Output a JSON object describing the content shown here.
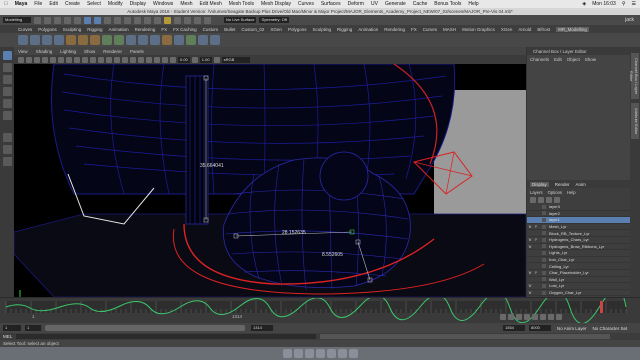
{
  "menubar": {
    "app": "Maya",
    "items": [
      "File",
      "Edit",
      "Create",
      "Select",
      "Modify",
      "Display",
      "Windows",
      "Mesh",
      "Edit Mesh",
      "Mesh Tools",
      "Mesh Display",
      "Curves",
      "Surfaces",
      "Deform",
      "UV",
      "Generate",
      "Cache",
      "Bonus Tools",
      "Help"
    ],
    "time": "Mon 16:03"
  },
  "window": {
    "title": "Autodesk Maya 2018 - Student Version: /Volumes/Seagate Backup Plus Drive/Old Mac/Minor & Major Project/MAJOR_Elements_Academy_Project_NEW/07_03/scenes/MAJOR_Pre-Vis 04.mb*"
  },
  "statusline": {
    "mode": "Modelling",
    "no_live": "No Live Surface",
    "symmetry": "Symmetry: Off",
    "user": "jack"
  },
  "shelftabs": {
    "items": [
      "Curves",
      "Polygons",
      "Sculpting",
      "Rigging",
      "Animation",
      "Rendering",
      "FX",
      "FX Caching",
      "Custom",
      "Bullet",
      "Custom_02",
      "XGen",
      "Polygons",
      "Sculpting",
      "Rigging",
      "Animation",
      "Rendering",
      "FX",
      "Curves",
      "MASH",
      "Motion Graphics",
      "XGen",
      "Arnold",
      "Bifrost",
      "MR_Modelling"
    ],
    "active_index": 24
  },
  "panelmenu": {
    "items": [
      "View",
      "Shading",
      "Lighting",
      "Show",
      "Renderer",
      "Panels"
    ]
  },
  "viewtools": {
    "field1": "0.00",
    "field2": "1.00",
    "colorspace": "sRGB gamma"
  },
  "viewport": {
    "measure_vertical": "35.664041",
    "measure_horizontal": "28.152635",
    "measure_diagonal": "8.552605"
  },
  "channelbox": {
    "tabs": [
      "Channel Box / Layer Editor"
    ],
    "menu": [
      "Channels",
      "Edit",
      "Object",
      "Show"
    ]
  },
  "sidetabs": [
    "Channel Box / Layer Editor",
    "Attribute Editor"
  ],
  "layerpanel": {
    "tabs": [
      "Display",
      "Render",
      "Anim"
    ],
    "active_tab": "Display",
    "menu": [
      "Layers",
      "Options",
      "Help"
    ],
    "layers": [
      {
        "name": "layer3",
        "v": "",
        "p": ""
      },
      {
        "name": "layer2",
        "v": "",
        "p": ""
      },
      {
        "name": "layer1",
        "v": "",
        "p": "",
        "selected": true
      },
      {
        "name": "Mesh_Lyr",
        "v": "V",
        "p": "P"
      },
      {
        "name": "Block_RB_Texture_Lyr",
        "v": "",
        "p": ""
      },
      {
        "name": "Hydrogens_Chars_Lyr",
        "v": "V",
        "p": "P"
      },
      {
        "name": "Hydrogens_Brow_Ribbons_Lyr",
        "v": "V",
        "p": ""
      },
      {
        "name": "Lights_Lyr",
        "v": "",
        "p": ""
      },
      {
        "name": "Iron_Char_Lyr",
        "v": "",
        "p": ""
      },
      {
        "name": "Ceiling_Lyr",
        "v": "",
        "p": ""
      },
      {
        "name": "Char_Placeholder_Lyr",
        "v": "V",
        "p": "P"
      },
      {
        "name": "Wall_Lyr",
        "v": "",
        "p": ""
      },
      {
        "name": "Lost_Lyr",
        "v": "V",
        "p": ""
      },
      {
        "name": "Oxygen_Char_Lyr",
        "v": "V",
        "p": ""
      },
      {
        "name": "Floor_Lyr",
        "v": "V",
        "p": "P"
      }
    ]
  },
  "timeline": {
    "ticks": [
      "1",
      "",
      "",
      "",
      "",
      "",
      "",
      "",
      "",
      "",
      "",
      "",
      "",
      "",
      "",
      "",
      "",
      "",
      "",
      "",
      "",
      "",
      "",
      "",
      "",
      "",
      "1314",
      "",
      "",
      "",
      "",
      ""
    ],
    "current_frame": "1314"
  },
  "rangebar": {
    "start": "1",
    "range_start": "1",
    "range_end": "1314",
    "anim_end": "1554",
    "end": "8000",
    "anim_layer": "No Anim Layer",
    "char_set": "No Character Set"
  },
  "cmdline": {
    "label": "MEL"
  },
  "helpline": {
    "text": "Select Tool: select an object"
  }
}
